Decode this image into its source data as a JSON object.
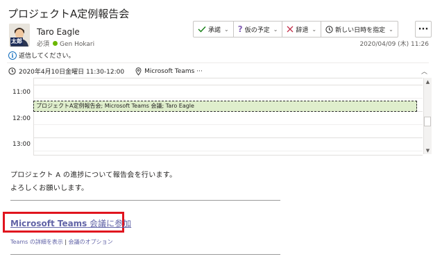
{
  "meeting": {
    "title": "プロジェクトA定例報告会",
    "organizer": "Taro Eagle",
    "required_label": "必須",
    "attendee": "Gen Hokari",
    "sent": "2020/04/09 (木) 11:26",
    "notice": "返信してください。",
    "when": "2020年4月10日金曜日 11:30-12:00",
    "where": "Microsoft Teams ···",
    "avatar_text": "太郎"
  },
  "toolbar": {
    "accept": "承諾",
    "tentative": "仮の予定",
    "decline": "辞退",
    "propose": "新しい日時を指定",
    "more": "···"
  },
  "calendar": {
    "times": [
      "11:00",
      "12:00",
      "13:00"
    ],
    "event_text": "プロジェクトA定例報告会; Microsoft Teams 会議; Taro Eagle"
  },
  "body": {
    "line1": "プロジェクト A の進捗について報告会を行います。",
    "line2": "よろしくお願いします。",
    "join_brand": "Microsoft Teams",
    "join_text": " 会議に参加",
    "link_details": "Teams の詳細を表示",
    "sep": "|",
    "link_options": "会議のオプション"
  },
  "colors": {
    "accent": "#6264a7",
    "highlight_box": "#e0141e",
    "event_fill": "#dfeecc",
    "present": "#6bb700"
  }
}
